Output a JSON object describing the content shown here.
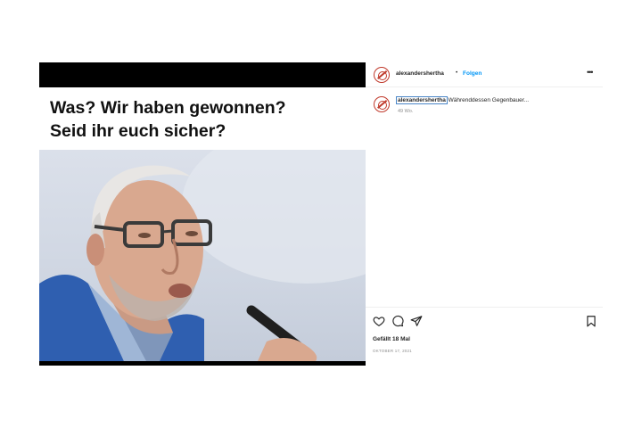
{
  "post_image": {
    "headline_line1": "Was? Wir haben gewonnen?",
    "headline_line2": "Seid ihr euch sicher?"
  },
  "header": {
    "username": "alexandershertha",
    "separator": "•",
    "follow_label": "Folgen",
    "more_label": "•••"
  },
  "caption": {
    "username": "alexandershertha",
    "text": "Währenddessen Gegenbauer...",
    "time": "49 Wo."
  },
  "actions": {
    "likes": "Gefällt 18 Mal",
    "date": "OKTOBER 17, 2021"
  },
  "colors": {
    "link": "#0095f6",
    "text": "#262626",
    "muted": "#8e8e8e",
    "avatar_ring": "#c0392b"
  },
  "icons": [
    "heart-icon",
    "comment-icon",
    "share-icon",
    "bookmark-icon",
    "more-icon"
  ]
}
